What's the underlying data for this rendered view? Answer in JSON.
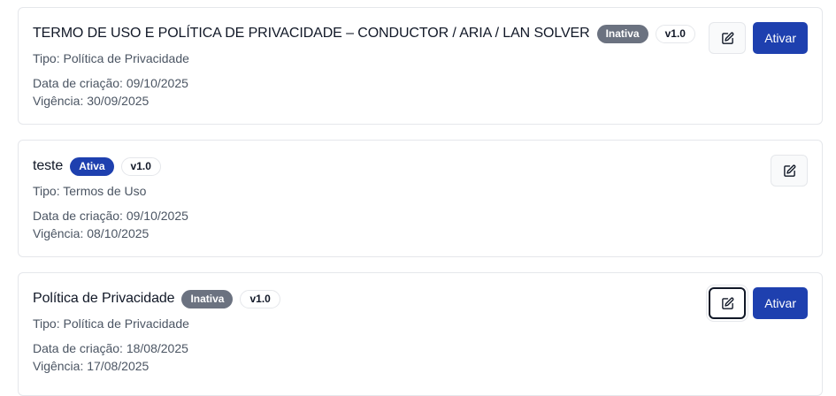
{
  "documents": [
    {
      "title": "TERMO DE USO E POLÍTICA DE PRIVACIDADE – CONDUCTOR / ARIA / LAN SOLVER",
      "status": "Inativa",
      "version": "v1.0",
      "type": "Tipo: Política de Privacidade",
      "created": "Data de criação: 09/10/2025",
      "validity": "Vigência: 30/09/2025",
      "activate_label": "Ativar"
    },
    {
      "title": "teste",
      "status": "Ativa",
      "version": "v1.0",
      "type": "Tipo: Termos de Uso",
      "created": "Data de criação: 09/10/2025",
      "validity": "Vigência: 08/10/2025"
    },
    {
      "title": "Política de Privacidade",
      "status": "Inativa",
      "version": "v1.0",
      "type": "Tipo: Política de Privacidade",
      "created": "Data de criação: 18/08/2025",
      "validity": "Vigência: 17/08/2025",
      "activate_label": "Ativar"
    }
  ],
  "icons": {
    "edit": "edit-icon"
  },
  "colors": {
    "primary": "#1e40af",
    "inactive_badge": "#6b7280",
    "border": "#e5e7eb"
  }
}
